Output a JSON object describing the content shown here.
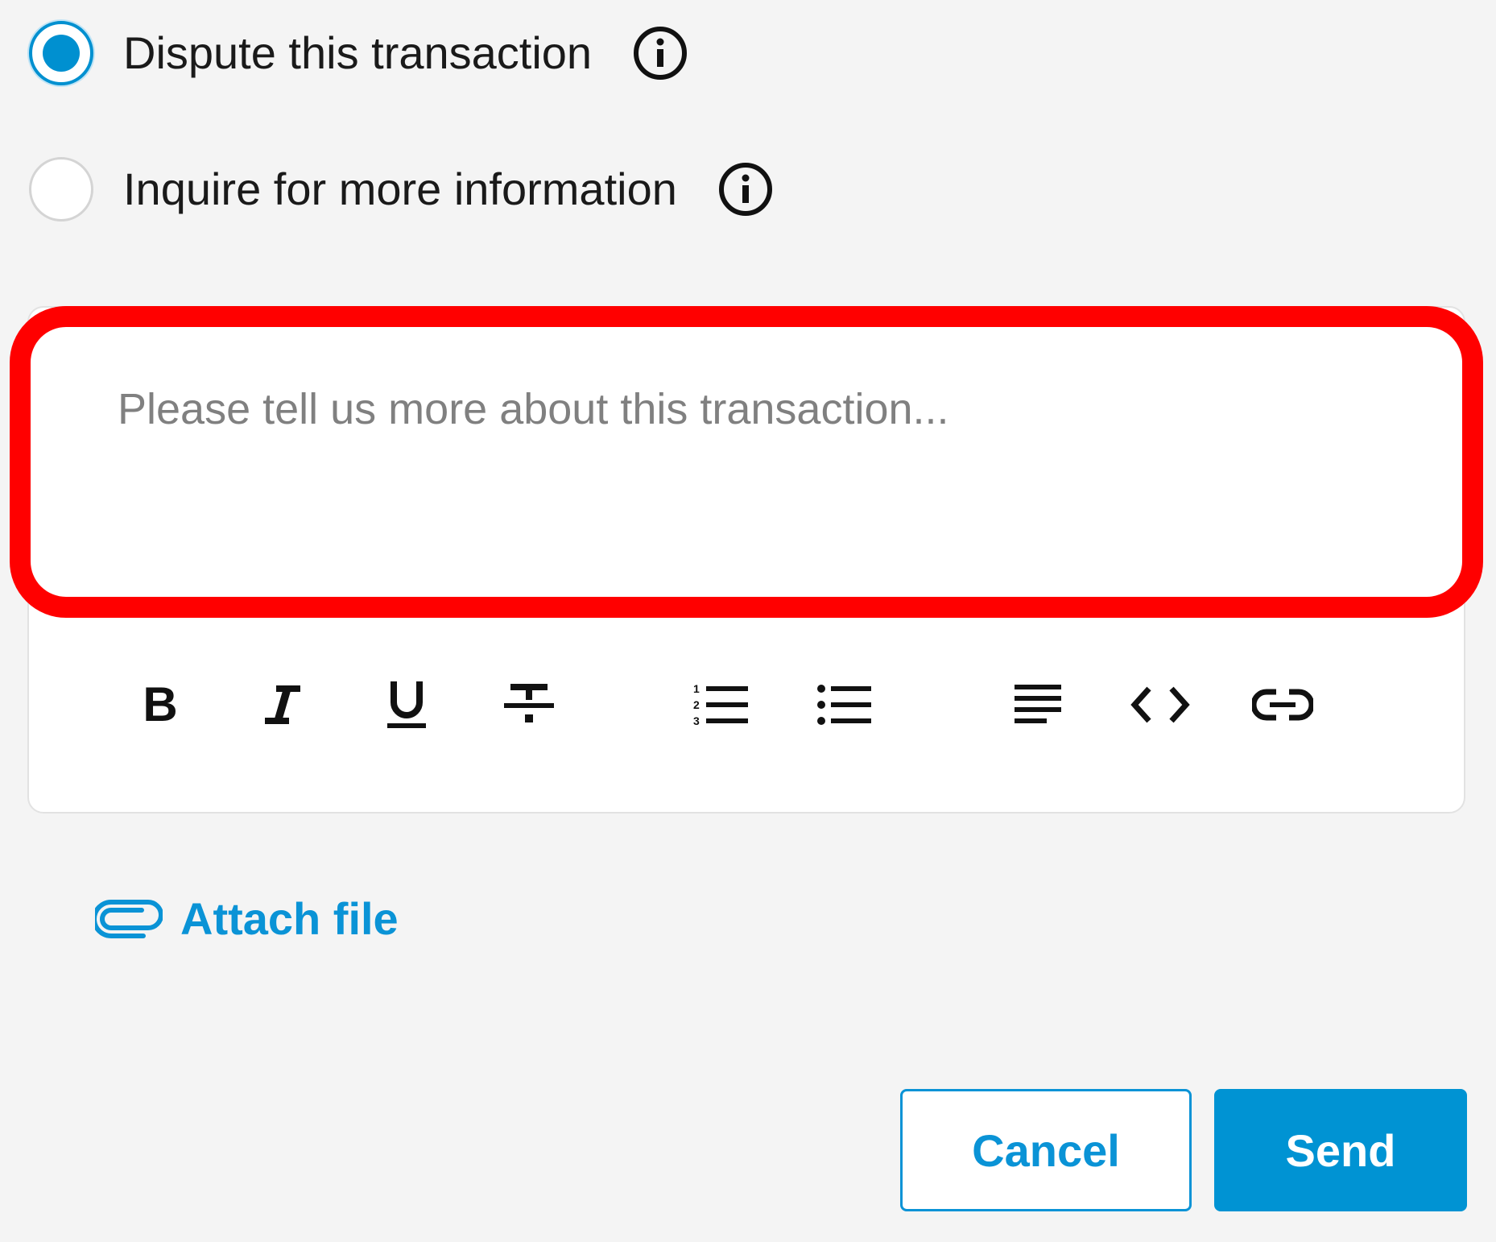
{
  "options": [
    {
      "label": "Dispute this transaction",
      "selected": true,
      "info_icon": "info-icon"
    },
    {
      "label": "Inquire for more information",
      "selected": false,
      "info_icon": "info-icon"
    }
  ],
  "editor": {
    "placeholder": "Please tell us more about this transaction...",
    "value": "",
    "toolbar": [
      {
        "name": "bold-icon"
      },
      {
        "name": "italic-icon"
      },
      {
        "name": "underline-icon"
      },
      {
        "name": "strikethrough-icon"
      },
      {
        "name": "numbered-list-icon"
      },
      {
        "name": "bulleted-list-icon"
      },
      {
        "name": "align-left-icon"
      },
      {
        "name": "code-icon"
      },
      {
        "name": "link-icon"
      }
    ]
  },
  "attach": {
    "label": "Attach file",
    "icon": "paperclip-icon"
  },
  "actions": {
    "cancel_label": "Cancel",
    "send_label": "Send"
  },
  "colors": {
    "accent": "#0093d3",
    "selected_radio": "#0090d0",
    "highlight": "#ff0000",
    "background": "#f4f4f4"
  }
}
